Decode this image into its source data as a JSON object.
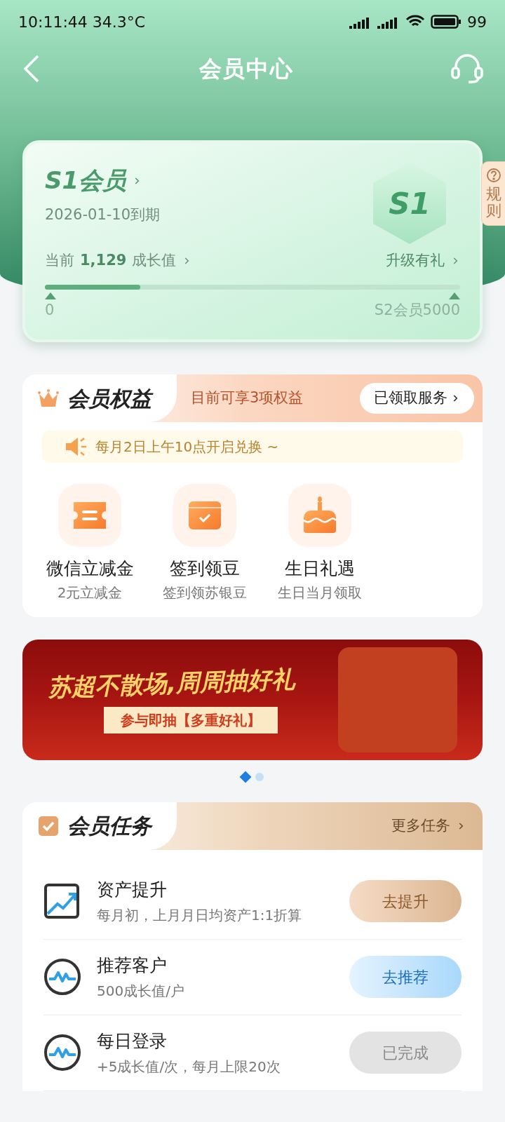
{
  "status_bar": {
    "time": "10:11:44",
    "temperature": "34.3°C",
    "battery": "99"
  },
  "header": {
    "title": "会员中心"
  },
  "rules_tab": {
    "label": "规则"
  },
  "member_card": {
    "tier": "S1会员",
    "expiry": "2026-01-10到期",
    "badge": "S1",
    "current_prefix": "当前",
    "current_value": "1,129",
    "current_suffix": "成长值",
    "upgrade_link": "升级有礼",
    "progress": {
      "level": 0.23,
      "start": "0",
      "end": "S2会员5000"
    }
  },
  "benefits": {
    "title": "会员权益",
    "summary": "目前可享3项权益",
    "claimed_button": "已领取服务",
    "notice": "每月2日上午10点开启兑换 ~",
    "items": [
      {
        "kind": "ticket",
        "name": "微信立减金",
        "desc": "2元立减金"
      },
      {
        "kind": "calendar",
        "name": "签到领豆",
        "desc": "签到领苏银豆"
      },
      {
        "kind": "cake",
        "name": "生日礼遇",
        "desc": "生日当月领取"
      }
    ]
  },
  "banner": {
    "title": "苏超不散场,周周抽好礼",
    "subtitle": "参与即抽【多重好礼】"
  },
  "carousel_dots": [
    {
      "selected": true
    },
    {
      "selected": false
    }
  ],
  "tasks": {
    "title": "会员任务",
    "more_link": "更多任务",
    "items": [
      {
        "kind": "chart",
        "name": "资产提升",
        "desc": "每月初，上月月日均资产1:1折算",
        "button": {
          "label": "去提升",
          "kind": "gold"
        }
      },
      {
        "kind": "pulse",
        "name": "推荐客户",
        "desc": "500成长值/户",
        "button": {
          "label": "去推荐",
          "kind": "blue"
        }
      },
      {
        "kind": "pulse",
        "name": "每日登录",
        "desc": "+5成长值/次，每月上限20次",
        "button": {
          "label": "已完成",
          "kind": "grey"
        }
      }
    ]
  }
}
